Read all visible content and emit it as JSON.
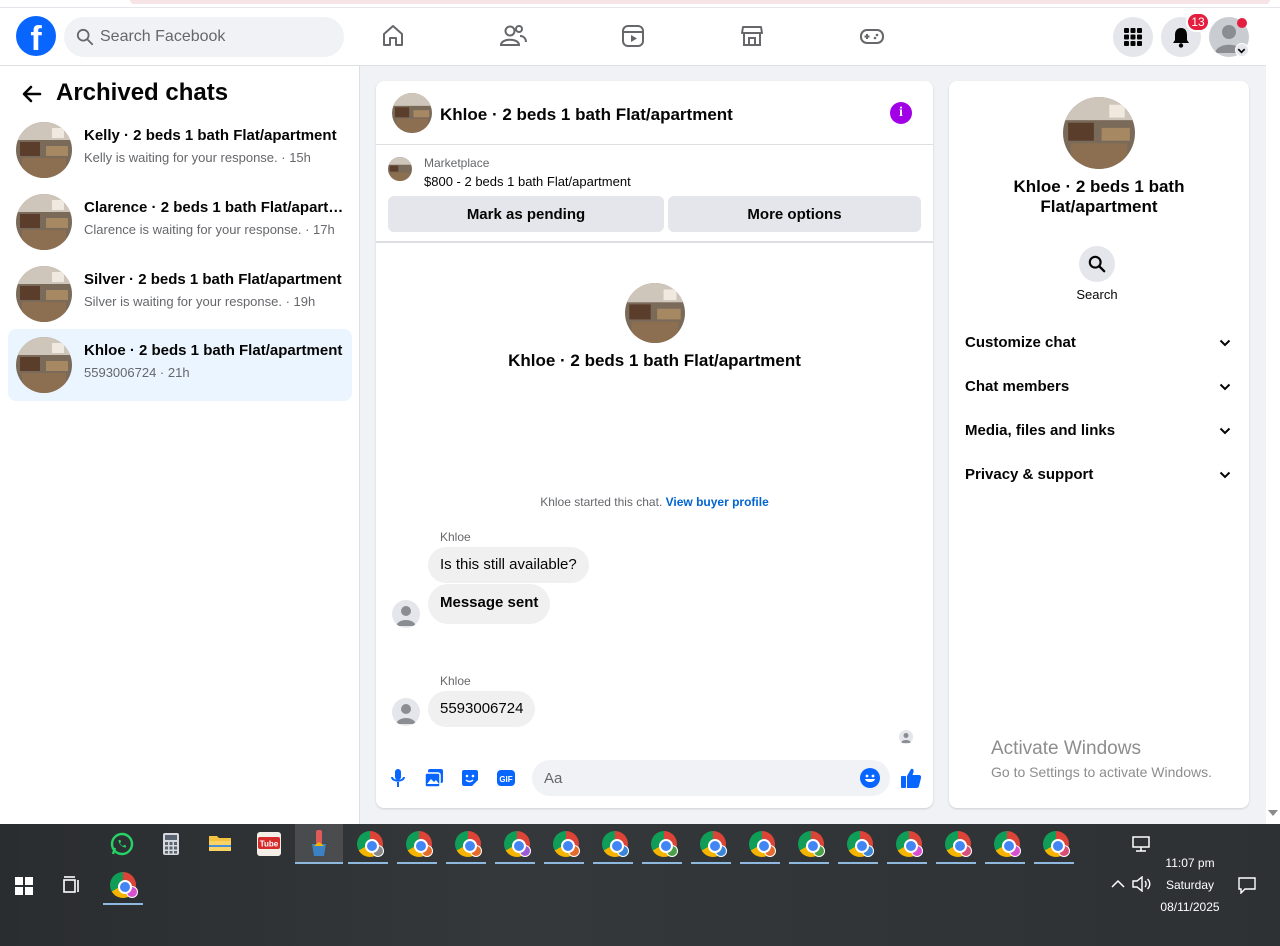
{
  "header": {
    "logo": "f",
    "search_placeholder": "Search Facebook",
    "notification_count": "13",
    "nav_icons": [
      "home-icon",
      "friends-icon",
      "video-icon",
      "marketplace-icon",
      "gaming-icon"
    ]
  },
  "left_panel": {
    "title": "Archived chats",
    "chats": [
      {
        "name": "Kelly · 2 beds 1 bath Flat/apartment",
        "sub": "Kelly is waiting for your response. · 15h"
      },
      {
        "name": "Clarence · 2 beds 1 bath Flat/apartment",
        "sub": "Clarence is waiting for your response. · 17h"
      },
      {
        "name": "Silver · 2 beds 1 bath Flat/apartment",
        "sub": "Silver is waiting for your response. · 19h"
      },
      {
        "name": "Khloe · 2 beds 1 bath Flat/apartment",
        "sub": "5593006724 · 21h"
      }
    ]
  },
  "conversation": {
    "title": "Khloe · 2 beds 1 bath Flat/apartment",
    "marketplace_label": "Marketplace",
    "listing": "$800 - 2 beds 1 bath Flat/apartment",
    "btn_pending": "Mark as pending",
    "btn_more": "More options",
    "intro_name": "Khloe · 2 beds 1 bath Flat/apartment",
    "started_text": "Khloe started this chat.",
    "buyer_profile_link": "View buyer profile",
    "messages": [
      {
        "sender": "Khloe",
        "text": "Is this still available?"
      },
      {
        "text": "Message sent"
      },
      {
        "sender": "Khloe",
        "text": "5593006724"
      }
    ],
    "composer_placeholder": "Aa"
  },
  "right_panel": {
    "title": "Khloe · 2 beds 1 bath Flat/apartment",
    "search_label": "Search",
    "sections": [
      "Customize chat",
      "Chat members",
      "Media, files and links",
      "Privacy & support"
    ]
  },
  "watermark": {
    "line1": "Activate Windows",
    "line2": "Go to Settings to activate Windows."
  },
  "taskbar": {
    "time": "11:07 pm",
    "day": "Saturday",
    "date": "08/11/2025",
    "pinned_apps": [
      "whatsapp-icon",
      "calculator-icon",
      "file-explorer-icon",
      "tube-app-icon",
      "paint-icon"
    ],
    "chrome_profile_colors": [
      "#888888",
      "#e46b2b",
      "#e46b2b",
      "#9c5bd6",
      "#e46b2b",
      "#3a86d9",
      "#4aa04a",
      "#3a86d9",
      "#e46b2b",
      "#4aa04a",
      "#3a86d9",
      "#d84fd0",
      "#d84f7a",
      "#d84fd0",
      "#d84f7a"
    ]
  }
}
